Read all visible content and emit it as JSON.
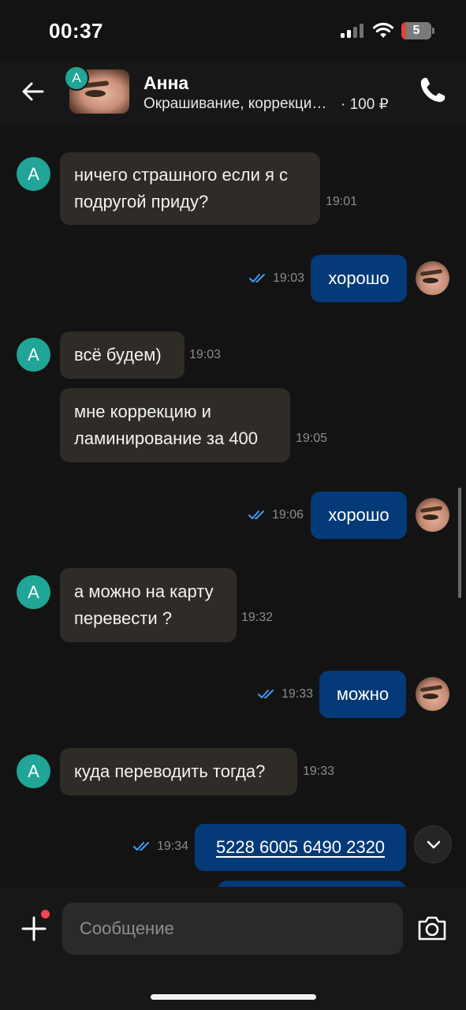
{
  "status_bar": {
    "time": "00:37",
    "battery_level": "5"
  },
  "header": {
    "avatar_letter": "A",
    "name": "Анна",
    "subtitle": "Окрашивание, коррекци…",
    "price": "· 100 ₽"
  },
  "messages": [
    {
      "side": "in",
      "lines": [
        "ничего страшного если я с",
        "подругой приду?"
      ],
      "time": "19:01"
    },
    {
      "side": "out",
      "text": "хорошо",
      "time": "19:03"
    },
    {
      "side": "in",
      "lines": [
        "всё будем)"
      ],
      "time": "19:03"
    },
    {
      "side": "in",
      "lines": [
        "мне коррекцию и",
        "ламинирование  за 400"
      ],
      "time": "19:05"
    },
    {
      "side": "out",
      "text": "хорошо",
      "time": "19:06"
    },
    {
      "side": "in",
      "lines": [
        "а можно на карту",
        "перевести ?"
      ],
      "time": "19:32"
    },
    {
      "side": "out",
      "text": "можно",
      "time": "19:33"
    },
    {
      "side": "in",
      "lines": [
        "куда переводить тогда?"
      ],
      "time": "19:33"
    },
    {
      "side": "out",
      "text": "5228 6005 6490 2320",
      "time": "19:34"
    }
  ],
  "input": {
    "placeholder": "Сообщение"
  },
  "colors": {
    "background": "#131313",
    "incoming_bubble": "#2f2b27",
    "outgoing_bubble": "#053a78",
    "avatar_accent": "#20a596",
    "read_ticks": "#3f9cf0",
    "notification_dot": "#f0464e"
  },
  "icons": {
    "back": "arrow-left-icon",
    "call": "phone-icon",
    "attach": "plus-icon",
    "camera": "camera-icon",
    "scroll": "chevron-down-icon",
    "read": "double-check-icon"
  }
}
